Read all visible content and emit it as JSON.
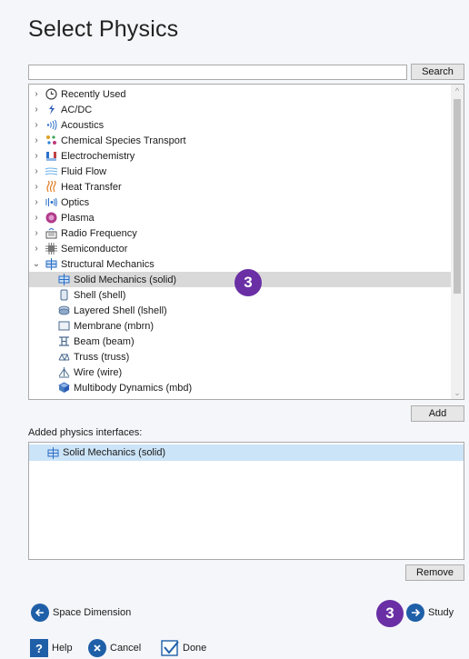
{
  "title": "Select Physics",
  "search": {
    "placeholder": "",
    "value": "",
    "button_label": "Search"
  },
  "tree": {
    "items": [
      {
        "label": "Recently Used",
        "icon": "clock-icon",
        "expanded": false
      },
      {
        "label": "AC/DC",
        "icon": "acdc-icon",
        "expanded": false
      },
      {
        "label": "Acoustics",
        "icon": "acoustics-icon",
        "expanded": false
      },
      {
        "label": "Chemical Species Transport",
        "icon": "chemical-species-icon",
        "expanded": false
      },
      {
        "label": "Electrochemistry",
        "icon": "electrochemistry-icon",
        "expanded": false
      },
      {
        "label": "Fluid Flow",
        "icon": "fluid-flow-icon",
        "expanded": false
      },
      {
        "label": "Heat Transfer",
        "icon": "heat-transfer-icon",
        "expanded": false
      },
      {
        "label": "Optics",
        "icon": "optics-icon",
        "expanded": false
      },
      {
        "label": "Plasma",
        "icon": "plasma-icon",
        "expanded": false
      },
      {
        "label": "Radio Frequency",
        "icon": "radio-frequency-icon",
        "expanded": false
      },
      {
        "label": "Semiconductor",
        "icon": "semiconductor-icon",
        "expanded": false
      },
      {
        "label": "Structural Mechanics",
        "icon": "structural-mechanics-icon",
        "expanded": true
      }
    ],
    "children": [
      {
        "label": "Solid Mechanics (solid)",
        "icon": "solid-mechanics-icon",
        "selected": true
      },
      {
        "label": "Shell (shell)",
        "icon": "shell-icon"
      },
      {
        "label": "Layered Shell (lshell)",
        "icon": "layered-shell-icon"
      },
      {
        "label": "Membrane (mbrn)",
        "icon": "membrane-icon"
      },
      {
        "label": "Beam (beam)",
        "icon": "beam-icon"
      },
      {
        "label": "Truss (truss)",
        "icon": "truss-icon"
      },
      {
        "label": "Wire (wire)",
        "icon": "wire-icon"
      },
      {
        "label": "Multibody Dynamics (mbd)",
        "icon": "multibody-icon"
      }
    ]
  },
  "badges": {
    "step": "3"
  },
  "add_button": "Add",
  "added": {
    "label": "Added physics interfaces:",
    "items": [
      {
        "label": "Solid Mechanics (solid)",
        "icon": "solid-mechanics-icon"
      }
    ]
  },
  "remove_button": "Remove",
  "nav": {
    "back_label": "Space Dimension",
    "next_label": "Study"
  },
  "bottom": {
    "help": "Help",
    "cancel": "Cancel",
    "done": "Done"
  },
  "colors": {
    "accent": "#1f5fa8",
    "badge": "#6a2fa4",
    "selection": "#cce4f7"
  }
}
